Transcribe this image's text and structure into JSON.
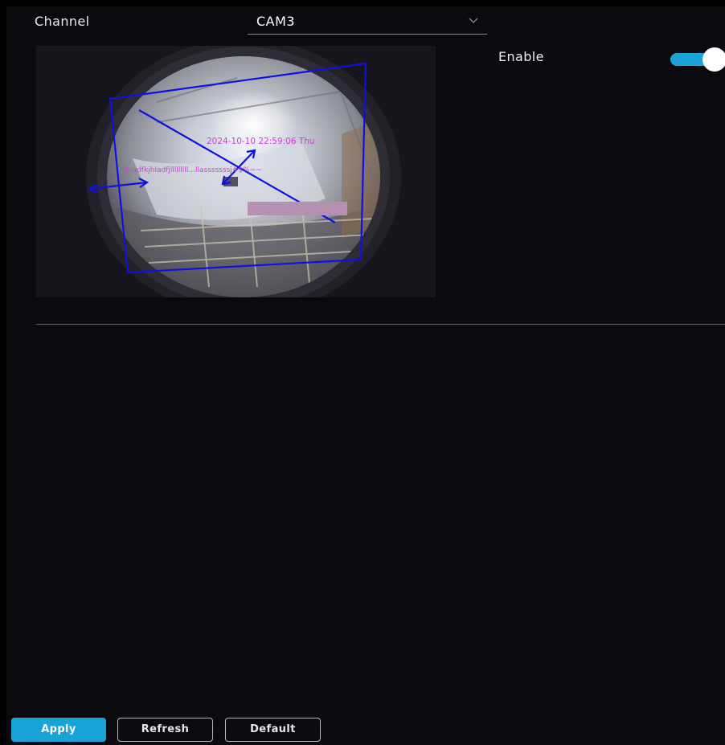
{
  "channel": {
    "label": "Channel",
    "selected": "CAM3",
    "dropdown_icon": "chevron-down-icon"
  },
  "enable": {
    "label": "Enable",
    "on": true
  },
  "preview": {
    "timestamp_osd": "2024-10-10 22:59:06 Thu",
    "custom_osd": "jlsadfkjhladfjlllllllll...llasssssssj#$%~~",
    "mask_color": "#b78fb0",
    "region_color": "#1010e0"
  },
  "buttons": {
    "apply": "Apply",
    "refresh": "Refresh",
    "default": "Default"
  },
  "colors": {
    "accent": "#1aa3d9",
    "background": "#0b0a0f",
    "osd_text": "#d03cd8"
  }
}
